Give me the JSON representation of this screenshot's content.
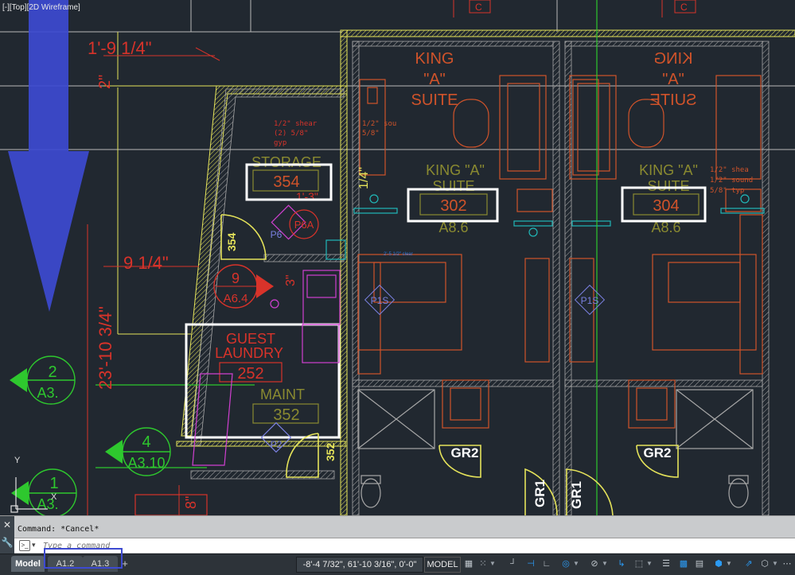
{
  "viewport": {
    "label": "[-][Top][2D Wireframe]",
    "dimensions": [
      "1'-9 1/4\"",
      "2\"",
      "9 1/4\"",
      "23'-10 3/4\"",
      "1/4\"",
      "3\"",
      "1'-3\"",
      "8\""
    ],
    "notes": {
      "shear_left": [
        "1/2\" shear",
        "(2) 5/8\"",
        "gyp"
      ],
      "sound_left": [
        "1/2\" sou",
        "5/8\""
      ],
      "shear_right": [
        "1/2\" shea",
        "1/2\" sound",
        "5/8\" typ"
      ]
    },
    "rooms": [
      {
        "name": "KING \"A\" SUITE",
        "top_line1": "KING",
        "top_line2": "\"A\"",
        "top_line3": "SUITE"
      },
      {
        "name_mid": "KING \"A\"",
        "name_mid2": "SUITE",
        "number": "302",
        "ref": "A8.6"
      },
      {
        "name_mid": "KING \"A\"",
        "name_mid2": "SUITE",
        "number": "304",
        "ref": "A8.6"
      }
    ],
    "storage": {
      "label": "STORAGE",
      "number": "354"
    },
    "laundry": {
      "line1": "GUEST",
      "line2": "LAUNDRY",
      "number": "252"
    },
    "maint": {
      "label": "MAINT",
      "number": "352"
    },
    "tags": {
      "p6": "P6",
      "p6a": "P6A",
      "p1s_a": "P1S",
      "p1s_b": "P1S",
      "p2": "P2",
      "door_354": "354",
      "door_352": "352",
      "gr2_a": "GR2",
      "gr2_b": "GR2",
      "gr1_a": "GR1",
      "gr1_b": "GR1",
      "callout_9_top": "9",
      "callout_9_bottom": "A6.4",
      "callout_4_top": "4",
      "callout_4_bottom": "A3.10",
      "callout_2_top": "2",
      "callout_2_bottom": "A3.",
      "callout_1_top": "1",
      "callout_1_bottom": "A3.",
      "top_c_a": "C",
      "top_c_b": "C",
      "small_note": "2'-5 1/2\" clear"
    },
    "ucs": {
      "y": "Y",
      "x": "X"
    }
  },
  "command": {
    "history": "Command: *Cancel*",
    "placeholder": "Type a command",
    "close_glyph": "✕",
    "wrench_glyph": "🔧",
    "prompt_glyph": ">_",
    "caret_glyph": "▾"
  },
  "status": {
    "tabs": [
      "Model",
      "A1.2",
      "A1.3"
    ],
    "active_tab": "Model",
    "add_glyph": "+",
    "coordinates": "-8'-4 7/32\", 61'-10 3/16\", 0'-0\"",
    "model_label": "MODEL",
    "icons": [
      "grid-icon",
      "snap-icon",
      "ortho-icon",
      "polar-icon",
      "osnap-icon",
      "otrack-icon",
      "lineweight-icon",
      "transparency-icon",
      "selection-cycling-icon",
      "annotation-scale-icon",
      "workspace-icon",
      "isolate-icon",
      "hardware-acceleration-icon",
      "customize-icon"
    ]
  },
  "colors": {
    "background": "#212830",
    "wall_yellow": "#e5e35a",
    "hatch_gray": "#a7a7a7",
    "red": "#d8332a",
    "orange": "#d0532a",
    "olive": "#8a8a30",
    "green": "#2ec82e",
    "magenta": "#d040d0",
    "cyan": "#20b8b8",
    "annotation_blue": "#3d4ad1",
    "highlight_white": "#ffffff"
  }
}
